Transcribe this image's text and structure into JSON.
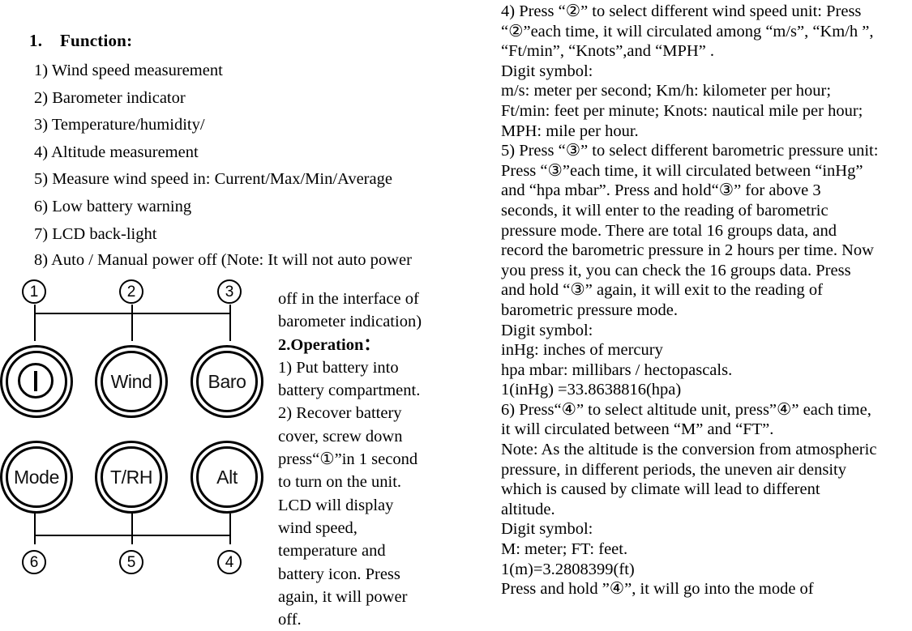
{
  "document": {
    "title": "Anemometer user manual page"
  },
  "left_column": {
    "heading": "1.    Function:",
    "items": [
      "1) Wind speed measurement",
      "2) Barometer indicator",
      "3) Temperature/humidity/",
      "4) Altitude measurement",
      "5) Measure wind speed in: Current/Max/Min/Average",
      "6) Low battery warning",
      "7) LCD back-light"
    ],
    "item8": "8) Auto / Manual power off (Note: It will not auto power"
  },
  "diagram": {
    "markers_top": [
      "1",
      "2",
      "3"
    ],
    "markers_bottom": [
      "6",
      "5",
      "4"
    ],
    "buttons_top": [
      {
        "label": "I",
        "name": "power-button"
      },
      {
        "label": "Wind",
        "name": "wind-button"
      },
      {
        "label": "Baro",
        "name": "baro-button"
      }
    ],
    "buttons_bottom": [
      {
        "label": "Mode",
        "name": "mode-button"
      },
      {
        "label": "T/RH",
        "name": "trh-button"
      },
      {
        "label": "Alt",
        "name": "alt-button"
      }
    ]
  },
  "middle_column": {
    "lines": [
      "off in the interface of",
      "barometer indication)",
      "2.Operation：",
      "1) Put battery into",
      "battery compartment.",
      "2) Recover battery",
      "cover, screw down",
      "press“①”in 1 second",
      "to turn on the unit.",
      "LCD will display",
      "wind speed,",
      "temperature and",
      "battery icon. Press",
      "again, it will power",
      "off."
    ],
    "bold_line_index": 2
  },
  "right_column": {
    "lines": [
      "4) Press “②” to select different wind speed unit: Press",
      "“②”each time, it will circulated among “m/s”, “Km/h ”,",
      "“Ft/min”, “Knots”,and “MPH” .",
      "Digit symbol:",
      "m/s: meter per second; Km/h: kilometer per hour;",
      "Ft/min: feet per minute;    Knots: nautical mile per hour;",
      "MPH: mile per hour.",
      "5) Press “③” to select different barometric pressure unit:",
      "Press “③”each time, it will circulated between “inHg”",
      "and “hpa mbar”. Press and hold“③” for above 3",
      "seconds, it will enter to the reading of barometric",
      "pressure mode. There are total 16 groups data, and",
      "record the barometric pressure in 2 hours per time. Now",
      "you press it, you can check the 16 groups data. Press",
      "and hold “③” again, it will exit to the reading of",
      "barometric pressure mode.",
      "Digit symbol:",
      "inHg: inches of mercury",
      "hpa mbar: millibars / hectopascals.",
      "1(inHg) =33.8638816(hpa)",
      "6) Press“④” to select altitude unit, press”④” each time,",
      "it will circulated between “M” and “FT”.",
      "Note: As the altitude is the conversion from atmospheric",
      "pressure, in different periods, the uneven air density",
      "which is caused by climate will lead to different",
      "altitude.",
      "Digit symbol:",
      "M: meter; FT: feet.",
      "1(m)=3.2808399(ft)",
      "Press and hold ”④”, it will go into the mode of"
    ]
  },
  "colors": {
    "ink": "#000000",
    "page": "#ffffff"
  }
}
